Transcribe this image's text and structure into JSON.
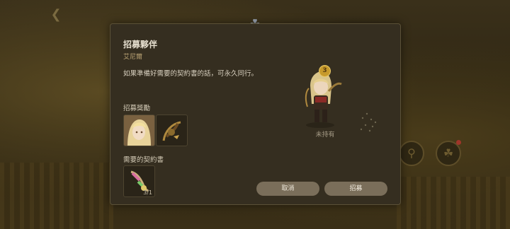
{
  "dialog": {
    "title": "招募夥伴",
    "subtitle": "艾尼爾",
    "description": "如果準備好需要的契約書的話，可永久同行。",
    "rewards_label": "招募獎勵",
    "contract_label": "需要的契約書",
    "contract_count": "3/1",
    "star_level": "3",
    "status": "未持有",
    "cancel_label": "取消",
    "recruit_label": "招募"
  },
  "icons": {
    "back": "back-arrow-icon",
    "emblem": "guild-emblem-icon",
    "search": "magnifier-icon",
    "party": "party-icon"
  }
}
